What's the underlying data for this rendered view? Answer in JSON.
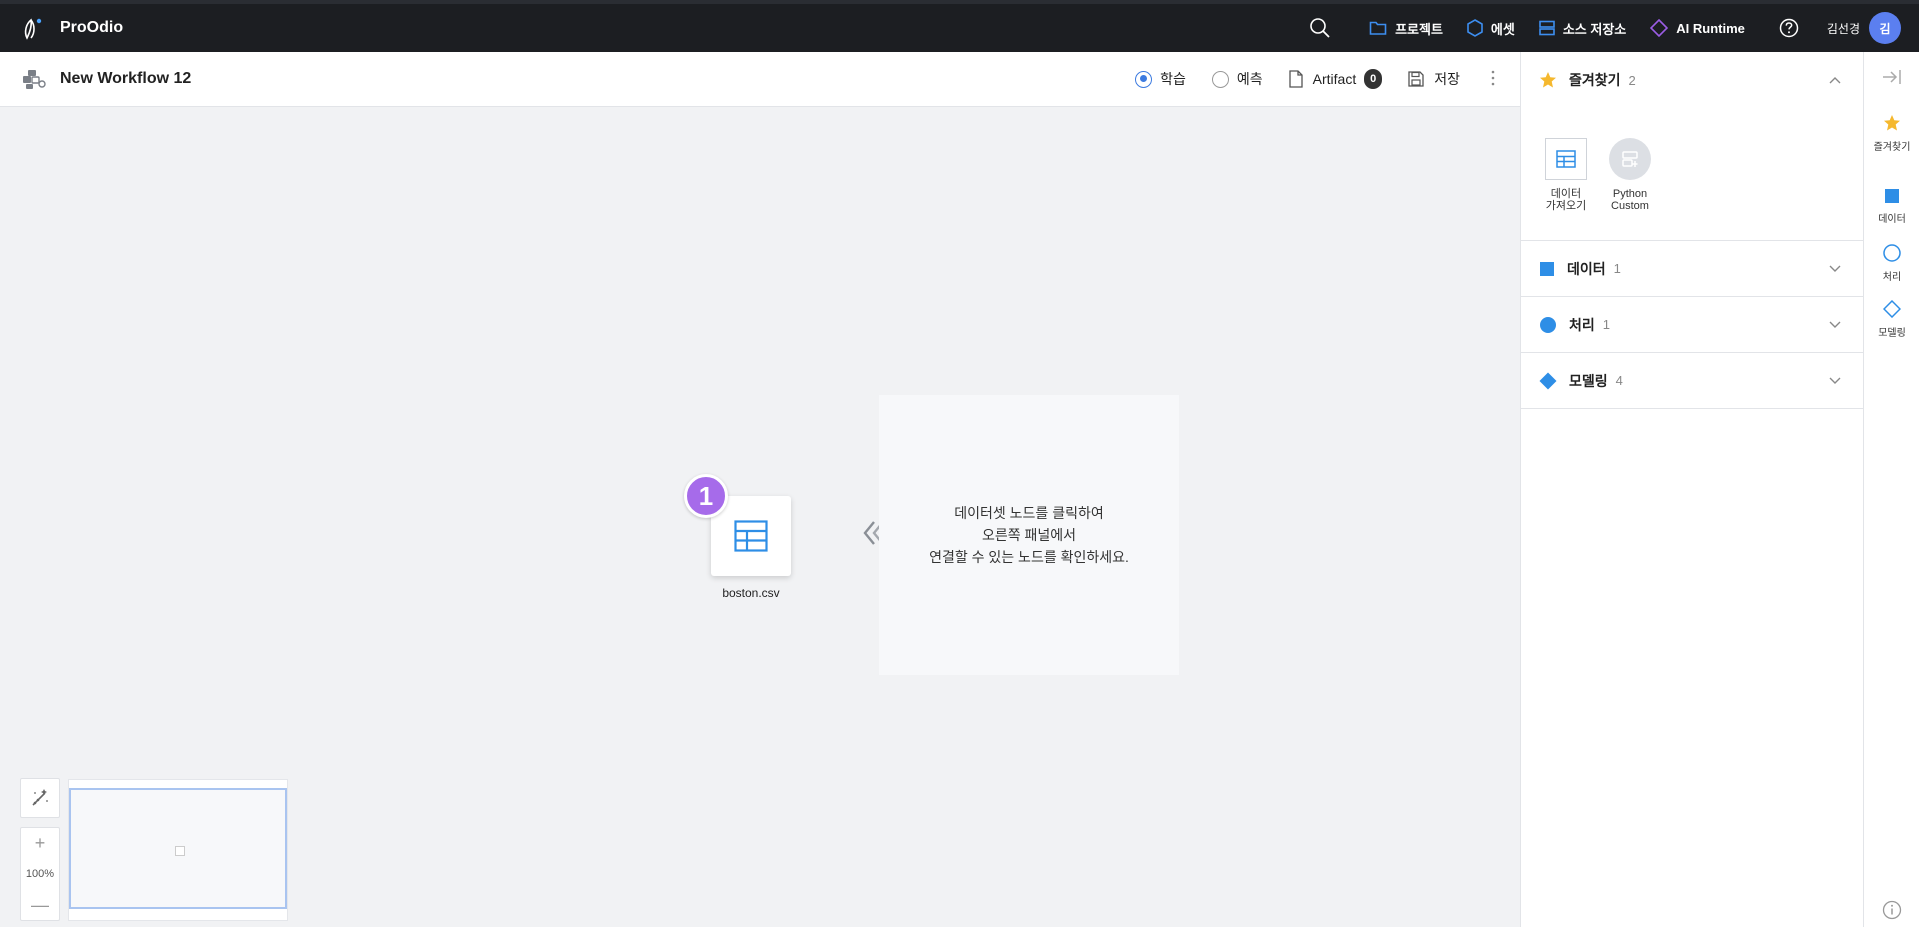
{
  "app": {
    "brand": "ProOdio"
  },
  "topnav": {
    "items": [
      {
        "label": "프로젝트",
        "icon": "folder-icon"
      },
      {
        "label": "에셋",
        "icon": "hexagon-icon"
      },
      {
        "label": "소스 저장소",
        "icon": "database-icon"
      },
      {
        "label": "AI Runtime",
        "icon": "diamond-icon"
      }
    ],
    "user_name": "김선경",
    "avatar_initial": "김"
  },
  "workflow": {
    "title": "New Workflow 12",
    "mode_train": "학습",
    "mode_predict": "예측",
    "artifact_label": "Artifact",
    "artifact_count": "0",
    "save_label": "저장",
    "selected_mode": "학습"
  },
  "canvas": {
    "node_step": "1",
    "node_label": "boston.csv",
    "hint_lines": [
      "데이터셋 노드를 클릭하여",
      "오른쪽 패널에서",
      "연결할 수 있는 노드를 확인하세요."
    ],
    "zoom": "100%",
    "zoom_in": "+",
    "zoom_out": "—"
  },
  "panel": {
    "favorites": {
      "title": "즐겨찾기",
      "count": "2",
      "items": [
        {
          "label_line1": "데이터",
          "label_line2": "가져오기"
        },
        {
          "label_line1": "Python",
          "label_line2": "Custom"
        }
      ]
    },
    "sections": [
      {
        "title": "데이터",
        "count": "1",
        "icon": "square-icon"
      },
      {
        "title": "처리",
        "count": "1",
        "icon": "circle-icon"
      },
      {
        "title": "모델링",
        "count": "4",
        "icon": "diamond-icon"
      }
    ]
  },
  "rail": {
    "items": [
      {
        "label": "즐겨찾기"
      },
      {
        "label": "데이터"
      },
      {
        "label": "처리"
      },
      {
        "label": "모델링"
      }
    ]
  },
  "colors": {
    "accent": "#3d7be0",
    "node_blue": "#2e8ee6",
    "star": "#f5b82e",
    "step_badge": "#a66bea",
    "ai_runtime": "#9b5de5",
    "topbar": "#1c1e22"
  }
}
